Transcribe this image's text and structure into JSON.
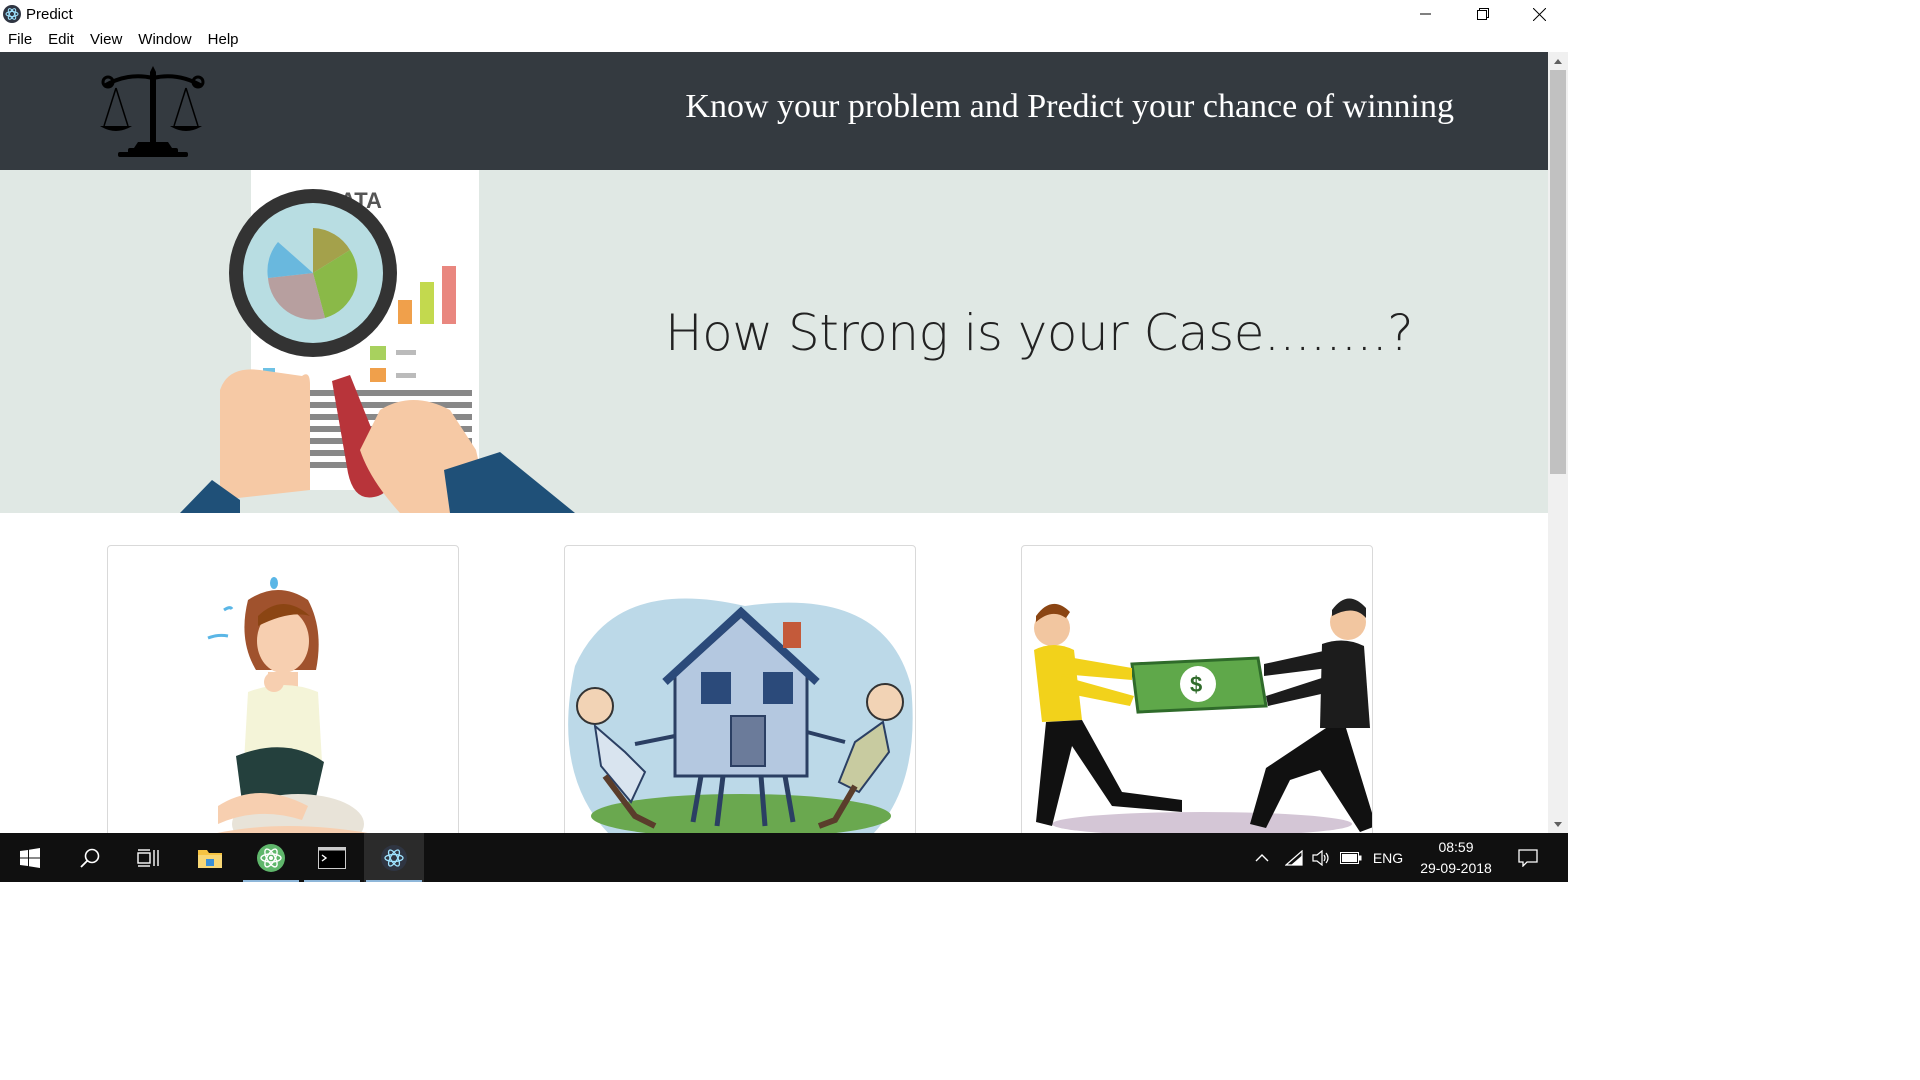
{
  "window": {
    "title": "Predict"
  },
  "menu": [
    "File",
    "Edit",
    "View",
    "Window",
    "Help"
  ],
  "header": {
    "tagline": "Know your problem and Predict your chance of winning"
  },
  "hero": {
    "title": "How Strong is your Case........?",
    "doc_text": "ATA"
  },
  "cards": [
    {
      "image": "worried-woman"
    },
    {
      "image": "property-dispute"
    },
    {
      "image": "money-dispute"
    }
  ],
  "taskbar": {
    "apps": [
      "start",
      "search",
      "task-view",
      "file-explorer",
      "atom",
      "terminal",
      "electron-app"
    ],
    "language": "ENG",
    "time": "08:59",
    "date": "29-09-2018"
  },
  "colors": {
    "header_bg": "#343a40",
    "hero_bg": "#e0e8e4",
    "taskbar_bg": "#101010"
  }
}
